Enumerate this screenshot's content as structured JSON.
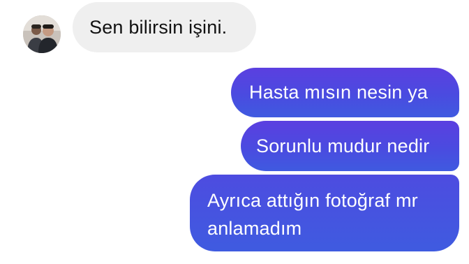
{
  "conversation": {
    "incoming": [
      {
        "text": "Sen bilirsin işini."
      }
    ],
    "outgoing": [
      {
        "text": "Hasta mısın nesin ya"
      },
      {
        "text": "Sorunlu mudur nedir"
      },
      {
        "text": "Ayrıca attığın fotoğraf mr anlamadım"
      }
    ]
  },
  "contact": {
    "avatar_icon": "user-photo-icon"
  },
  "colors": {
    "incoming_bubble": "#efefef",
    "outgoing_bubble_top": "#5b3fe0",
    "outgoing_bubble_bottom": "#3f5ae0",
    "background": "#ffffff"
  }
}
